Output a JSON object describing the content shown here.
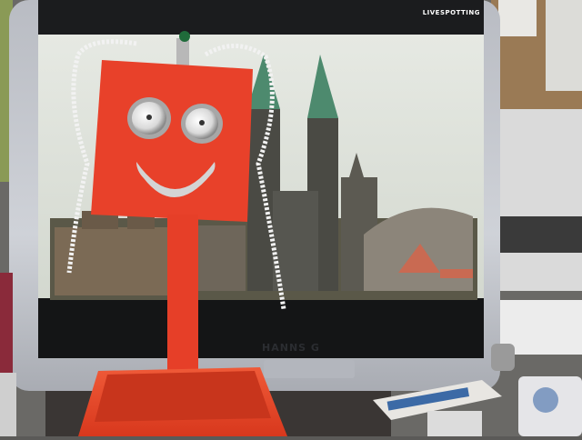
{
  "screen_label": "LIVESPOTTING",
  "monitor_brand": "HANNS G",
  "colors": {
    "robot_red": "#e8412a",
    "monitor_bezel": "#c9ccd2",
    "sky": "#dfe3dc"
  }
}
